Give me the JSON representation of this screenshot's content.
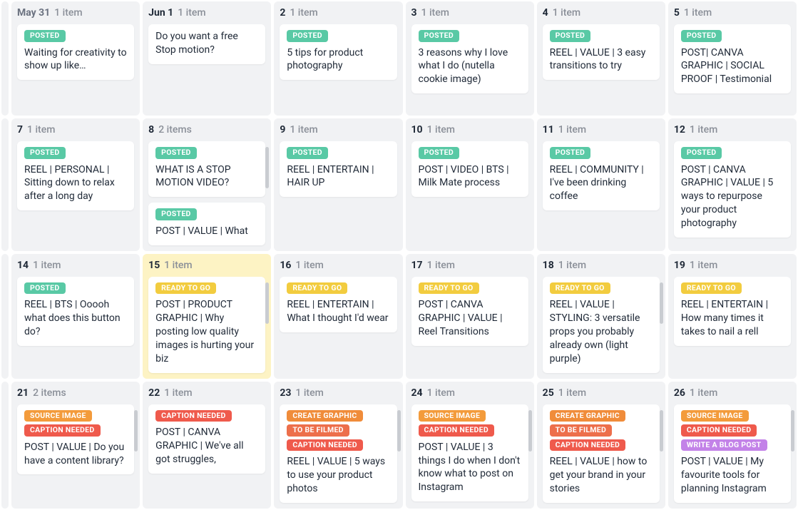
{
  "tags": {
    "posted": "POSTED",
    "ready": "READY TO GO",
    "source": "SOURCE IMAGE",
    "caption": "CAPTION NEEDED",
    "create": "CREATE GRAPHIC",
    "film": "TO BE FILMED",
    "blog": "WRITE A BLOG POST"
  },
  "rows": [
    [
      {
        "day": "May 31",
        "muted": true,
        "count": "1 item",
        "cards": [
          {
            "tags": [
              "posted"
            ],
            "title": "Waiting for creativity to show up like…"
          }
        ]
      },
      {
        "day": "Jun 1",
        "count": "1 item",
        "cards": [
          {
            "tags": [],
            "title": "Do you want a free Stop motion?"
          }
        ]
      },
      {
        "day": "2",
        "count": "1 item",
        "cards": [
          {
            "tags": [
              "posted"
            ],
            "title": "5 tips for product photography"
          }
        ]
      },
      {
        "day": "3",
        "count": "1 item",
        "cards": [
          {
            "tags": [
              "posted"
            ],
            "title": "3 reasons why I love what I do (nutella cookie image)"
          }
        ]
      },
      {
        "day": "4",
        "count": "1 item",
        "cards": [
          {
            "tags": [
              "posted"
            ],
            "title": "REEL | VALUE | 3 easy transitions to try"
          }
        ]
      },
      {
        "day": "5",
        "count": "1 item",
        "cards": [
          {
            "tags": [
              "posted"
            ],
            "title": "POST| CANVA GRAPHIC | SOCIAL PROOF | Testimonial"
          }
        ]
      }
    ],
    [
      {
        "day": "7",
        "count": "1 item",
        "cards": [
          {
            "tags": [
              "posted"
            ],
            "title": "REEL | PERSONAL | Sitting down to relax after a long day"
          }
        ]
      },
      {
        "day": "8",
        "count": "2 items",
        "scroll": true,
        "cards": [
          {
            "tags": [
              "posted"
            ],
            "title": "WHAT IS A STOP MOTION VIDEO?"
          },
          {
            "tags": [
              "posted"
            ],
            "title": "POST | VALUE | What"
          }
        ]
      },
      {
        "day": "9",
        "count": "1 item",
        "cards": [
          {
            "tags": [
              "posted"
            ],
            "title": "REEL | ENTERTAIN | HAIR UP"
          }
        ]
      },
      {
        "day": "10",
        "count": "1 item",
        "cards": [
          {
            "tags": [
              "posted"
            ],
            "title": "POST | VIDEO | BTS | Milk Mate process"
          }
        ]
      },
      {
        "day": "11",
        "count": "1 item",
        "cards": [
          {
            "tags": [
              "posted"
            ],
            "title": "REEL | COMMUNITY | I've been drinking coffee"
          }
        ]
      },
      {
        "day": "12",
        "count": "1 item",
        "cards": [
          {
            "tags": [
              "posted"
            ],
            "title": "POST | CANVA GRAPHIC | VALUE | 5 ways to repurpose your product photography"
          }
        ]
      }
    ],
    [
      {
        "day": "14",
        "count": "1 item",
        "cards": [
          {
            "tags": [
              "posted"
            ],
            "title": "REEL | BTS | Ooooh what does this button do?"
          }
        ]
      },
      {
        "day": "15",
        "count": "1 item",
        "highlight": true,
        "scroll": true,
        "cards": [
          {
            "tags": [
              "ready"
            ],
            "title": "POST | PRODUCT GRAPHIC | Why posting low quality images is hurting your biz"
          }
        ]
      },
      {
        "day": "16",
        "count": "1 item",
        "cards": [
          {
            "tags": [
              "ready"
            ],
            "title": "REEL | ENTERTAIN | What I thought I'd wear"
          }
        ]
      },
      {
        "day": "17",
        "count": "1 item",
        "cards": [
          {
            "tags": [
              "ready"
            ],
            "title": "POST | CANVA GRAPHIC | VALUE | Reel Transitions"
          }
        ]
      },
      {
        "day": "18",
        "count": "1 item",
        "scroll": true,
        "cards": [
          {
            "tags": [
              "ready"
            ],
            "title": "REEL | VALUE | STYLING: 3 versatile props you probably already own (light purple)"
          }
        ]
      },
      {
        "day": "19",
        "count": "1 item",
        "cards": [
          {
            "tags": [
              "ready"
            ],
            "title": "REEL | ENTERTAIN | How many times it takes to nail a rell"
          }
        ]
      }
    ],
    [
      {
        "day": "21",
        "count": "2 items",
        "scroll": true,
        "cards": [
          {
            "tags": [
              "source",
              "caption"
            ],
            "title": "POST | VALUE | Do you have a content library?"
          }
        ]
      },
      {
        "day": "22",
        "count": "1 item",
        "cards": [
          {
            "tags": [
              "caption"
            ],
            "title": "POST | CANVA GRAPHIC | We've all got struggles,"
          }
        ]
      },
      {
        "day": "23",
        "count": "1 item",
        "scroll": true,
        "cards": [
          {
            "tags": [
              "create",
              "film",
              "caption"
            ],
            "title": "REEL | VALUE | 5 ways to use your product photos"
          }
        ]
      },
      {
        "day": "24",
        "count": "1 item",
        "scroll": true,
        "cards": [
          {
            "tags": [
              "source",
              "caption"
            ],
            "title": "POST | VALUE | 3 things I do when I don't know what to post on Instagram"
          }
        ]
      },
      {
        "day": "25",
        "count": "1 item",
        "scroll": true,
        "cards": [
          {
            "tags": [
              "create",
              "film",
              "caption"
            ],
            "title": "REEL | VALUE | how to get your brand in your stories"
          }
        ]
      },
      {
        "day": "26",
        "count": "1 item",
        "scroll": true,
        "cards": [
          {
            "tags": [
              "source",
              "caption",
              "blog"
            ],
            "title": "POST | VALUE | My favourite tools for planning Instagram"
          }
        ]
      }
    ]
  ]
}
